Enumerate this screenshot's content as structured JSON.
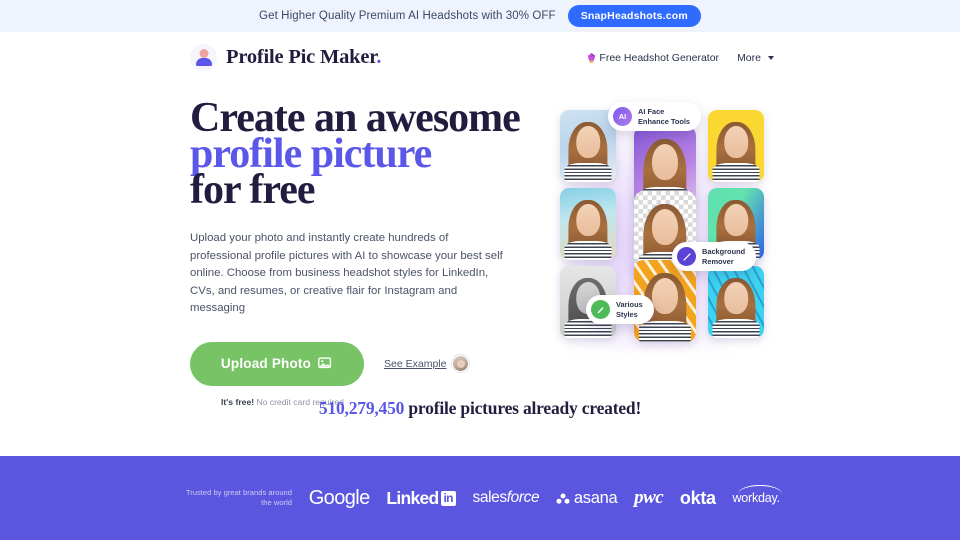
{
  "promo": {
    "text": "Get Higher Quality Premium AI Headshots with 30% OFF",
    "cta_label": "SnapHeadshots.com"
  },
  "header": {
    "brand_name": "Profile Pic Maker",
    "brand_dot": ".",
    "brand_icon": "person-avatar-icon",
    "nav": {
      "free_generator_label": "Free Headshot Generator",
      "free_generator_icon": "gem-icon",
      "more_label": "More",
      "more_icon": "chevron-down-icon"
    }
  },
  "hero": {
    "headline_line1": "Create an awesome",
    "headline_line2": "profile picture",
    "headline_line3": "for free",
    "paragraph": "Upload your photo and instantly create hundreds of professional profile pictures with AI to showcase your best self online. Choose from business headshot styles for LinkedIn, CVs, and resumes, or creative flair for Instagram and messaging",
    "upload_button_label": "Upload Photo",
    "upload_button_icon": "image-icon",
    "see_example_label": "See Example",
    "see_example_avatar": "user-avatar",
    "free_note_bold": "It's free!",
    "free_note_rest": "No credit card required",
    "accent_color": "#5b57e8",
    "button_color": "#77c365"
  },
  "collage": {
    "tiles": [
      {
        "name": "tile-beach-blur",
        "style": "bg-beachblur"
      },
      {
        "name": "tile-purple-gradient",
        "style": "bg-purple"
      },
      {
        "name": "tile-yellow",
        "style": "bg-yellow"
      },
      {
        "name": "tile-beach",
        "style": "bg-beach"
      },
      {
        "name": "tile-transparent-checker",
        "style": "bg-checker"
      },
      {
        "name": "tile-mint-blue",
        "style": "bg-mint"
      },
      {
        "name": "tile-grayscale",
        "style": "bg-gray"
      },
      {
        "name": "tile-orange-pattern",
        "style": "bg-orange"
      },
      {
        "name": "tile-cyan-pattern",
        "style": "bg-cyan"
      }
    ],
    "badges": [
      {
        "icon_label": "AI",
        "line1": "AI Face",
        "line2": "Enhance Tools"
      },
      {
        "icon_label": "",
        "line1": "Background",
        "line2": "Remover"
      },
      {
        "icon_label": "",
        "line1": "Various",
        "line2": "Styles"
      }
    ]
  },
  "counter": {
    "number": "510,279,450",
    "text": " profile pictures already created!"
  },
  "brands": {
    "trusted_line1": "Trusted by great brands around",
    "trusted_line2": "the world",
    "background_color": "#5a56e0",
    "logos": [
      {
        "name": "google",
        "label": "Google"
      },
      {
        "name": "linkedin",
        "label": "Linked",
        "suffix": "in"
      },
      {
        "name": "salesforce",
        "label": "sales",
        "suffix": "force"
      },
      {
        "name": "asana",
        "label": "asana"
      },
      {
        "name": "pwc",
        "label": "pwc"
      },
      {
        "name": "okta",
        "label": "okta"
      },
      {
        "name": "workday",
        "label": "workday."
      }
    ]
  }
}
